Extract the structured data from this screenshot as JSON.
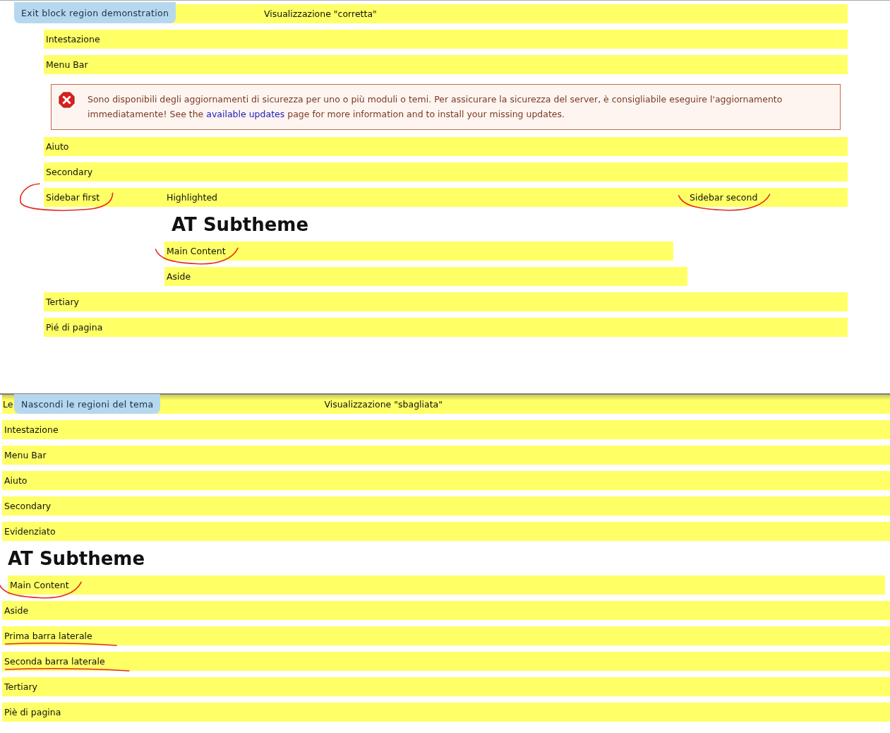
{
  "sheets": [
    {
      "tab": "Exit block region demonstration",
      "caption": "Visualizzazione \"corretta\"",
      "regions": [
        {
          "kind": "region",
          "label": "Intestazione",
          "circled": false,
          "underlined": false
        },
        {
          "kind": "region",
          "label": "Menu Bar",
          "circled": false,
          "underlined": false
        },
        {
          "kind": "message",
          "text_before": "Sono disponibili degli aggiornamenti di sicurezza per uno o più moduli o temi. Per assicurare la sicurezza del server, è consigliabile eseguire l'aggiornamento immediatamente! See the",
          "link": "available updates",
          "text_after": "page for more information and to install your missing updates."
        },
        {
          "kind": "region",
          "label": "Aiuto",
          "circled": false,
          "underlined": false
        },
        {
          "kind": "region",
          "label": "Secondary",
          "circled": false,
          "underlined": false
        },
        {
          "kind": "columns",
          "columns": [
            {
              "label": "Sidebar first",
              "circled": true,
              "underlined": false
            },
            {
              "label": "Highlighted",
              "circled": false,
              "underlined": false
            },
            {
              "label": "Sidebar second",
              "circled": false,
              "underlined": true
            }
          ]
        },
        {
          "kind": "heading",
          "label": "AT Subtheme"
        },
        {
          "kind": "inset",
          "label": "Main Content",
          "circled": false,
          "underlined": true
        },
        {
          "kind": "inset",
          "label": "Aside",
          "circled": false,
          "underlined": false
        },
        {
          "kind": "region",
          "label": "Tertiary",
          "circled": false,
          "underlined": false
        },
        {
          "kind": "region",
          "label": "Pié di pagina",
          "circled": false,
          "underlined": false
        }
      ]
    },
    {
      "tab": "Nascondi le regioni del tema",
      "caption": "Visualizzazione \"sbagliata\"",
      "first_label": "Le",
      "regions": [
        {
          "kind": "region",
          "label": "Intestazione",
          "circled": false,
          "underlined": false
        },
        {
          "kind": "region",
          "label": "Menu Bar",
          "circled": false,
          "underlined": false
        },
        {
          "kind": "region",
          "label": "Aiuto",
          "circled": false,
          "underlined": false
        },
        {
          "kind": "region",
          "label": "Secondary",
          "circled": false,
          "underlined": false
        },
        {
          "kind": "region",
          "label": "Evidenziato",
          "circled": false,
          "underlined": false
        },
        {
          "kind": "heading",
          "label": "AT Subtheme"
        },
        {
          "kind": "inset",
          "label": "Main Content",
          "circled": false,
          "underlined": true
        },
        {
          "kind": "region",
          "label": "Aside",
          "circled": false,
          "underlined": false
        },
        {
          "kind": "region",
          "label": "Prima barra laterale",
          "circled": false,
          "underlined": true
        },
        {
          "kind": "region",
          "label": "Seconda barra laterale",
          "circled": false,
          "underlined": true
        },
        {
          "kind": "region",
          "label": "Tertiary",
          "circled": false,
          "underlined": false
        },
        {
          "kind": "region",
          "label": "Piè di pagina",
          "circled": false,
          "underlined": false
        }
      ]
    }
  ]
}
